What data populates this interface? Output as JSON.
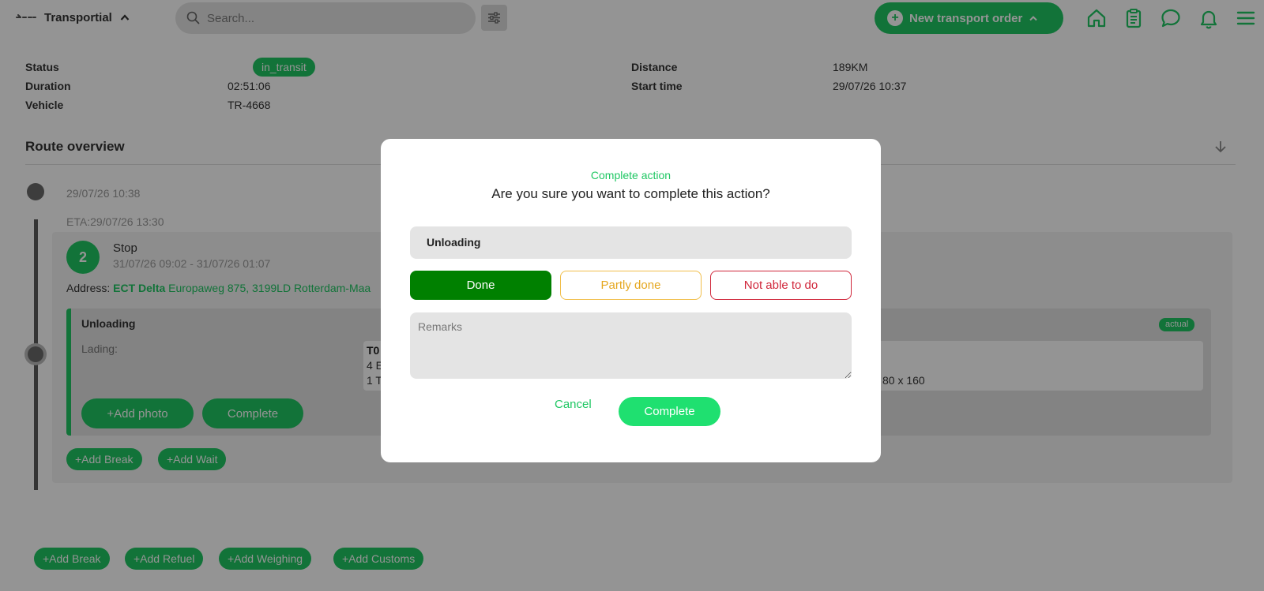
{
  "app": {
    "name": "Transportial",
    "search_placeholder": "Search...",
    "new_order_label": "New transport order"
  },
  "nav": {
    "icons": [
      "home-icon",
      "clipboard-icon",
      "chat-icon",
      "bell-icon",
      "menu-icon"
    ]
  },
  "details": {
    "status_label": "Status",
    "status_value": "in_transit",
    "duration_label": "Duration",
    "duration_value": "02:51:06",
    "vehicle_label": "Vehicle",
    "vehicle_value": "TR-4668",
    "distance_label": "Distance",
    "distance_value": "189KM",
    "start_time_label": "Start time",
    "start_time_value": "29/07/26 10:37"
  },
  "route": {
    "title": "Route overview",
    "start_time": "29/07/26 10:38",
    "eta": "ETA:29/07/26 13:30",
    "stop": {
      "number": "2",
      "label": "Stop",
      "times": "31/07/26 09:02 - 31/07/26 01:07",
      "address_prefix": "Address:",
      "address_name": "ECT Delta",
      "address_value": "Europaweg 875, 3199LD Rotterdam-Maa",
      "action": {
        "title": "Unloading",
        "lading_label": "Lading:",
        "lading_code": "T0",
        "lading_line1": "4 E",
        "lading_line2": "1 T",
        "lading_dims": "80 x 160",
        "badge": "actual",
        "add_photo_label": "+Add photo",
        "complete_label": "Complete"
      },
      "add_break_label": "+Add Break",
      "add_wait_label": "+Add Wait"
    },
    "bottom_actions": [
      "+Add Break",
      "+Add Refuel",
      "+Add Weighing",
      "+Add Customs"
    ]
  },
  "modal": {
    "title": "Complete action",
    "question": "Are you sure you want to complete this action?",
    "action_name": "Unloading",
    "done_label": "Done",
    "partly_label": "Partly done",
    "not_able_label": "Not able to do",
    "remarks_placeholder": "Remarks",
    "cancel_label": "Cancel",
    "complete_label": "Complete"
  },
  "colors": {
    "brand_green": "#1fc763",
    "done_green": "#008000",
    "partly_amber": "#e5a71f",
    "error_red": "#d0263a"
  }
}
